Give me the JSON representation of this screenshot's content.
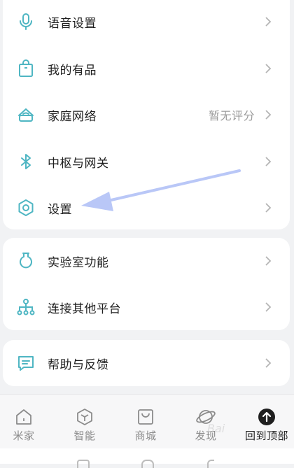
{
  "accent_color": "#4fb6c3",
  "menu_group_1": [
    {
      "label": "语音设置",
      "icon": "microphone-icon"
    },
    {
      "label": "我的有品",
      "icon": "shopping-bag-icon"
    },
    {
      "label": "家庭网络",
      "icon": "router-icon",
      "value": "暂无评分"
    },
    {
      "label": "中枢与网关",
      "icon": "bluetooth-icon"
    },
    {
      "label": "设置",
      "icon": "settings-hexagon-icon"
    }
  ],
  "menu_group_2": [
    {
      "label": "实验室功能",
      "icon": "lab-flask-icon"
    },
    {
      "label": "连接其他平台",
      "icon": "network-nodes-icon"
    }
  ],
  "menu_group_3": [
    {
      "label": "帮助与反馈",
      "icon": "feedback-message-icon"
    }
  ],
  "tabs": [
    {
      "label": "米家",
      "icon": "home-icon"
    },
    {
      "label": "智能",
      "icon": "smart-cube-icon"
    },
    {
      "label": "商城",
      "icon": "store-bag-icon"
    },
    {
      "label": "发现",
      "icon": "planet-icon"
    },
    {
      "label": "回到顶部",
      "icon": "back-to-top-icon"
    }
  ],
  "watermark": "Bai"
}
